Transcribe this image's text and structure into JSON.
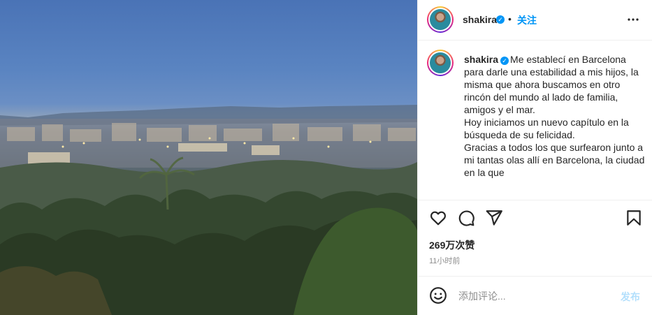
{
  "post": {
    "image_alt_icon": "city-landscape-photo",
    "header": {
      "username": "shakira",
      "separator": "•",
      "follow_label": "关注",
      "more_label": "•••"
    },
    "caption": {
      "username": "shakira",
      "text": "Me establecí en Barcelona para darle una estabilidad a mis hijos, la misma que ahora buscamos en otro rincón del mundo al lado de familia, amigos y el mar.\nHoy iniciamos un nuevo capítulo en la búsqueda de su felicidad.\nGracias a todos los que surfearon junto a mi tantas olas allí en Barcelona, la ciudad en la que"
    },
    "actions": {
      "icons": [
        "heart-icon",
        "comment-icon",
        "share-icon",
        "bookmark-icon"
      ]
    },
    "likes": "269万次赞",
    "time": "11小时前",
    "comment": {
      "placeholder": "添加评论...",
      "post_label": "发布"
    }
  },
  "colors": {
    "accent": "#0095f6",
    "verified": "#0095f6",
    "post_disabled": "#b2dffc",
    "muted": "#8e8e8e"
  }
}
